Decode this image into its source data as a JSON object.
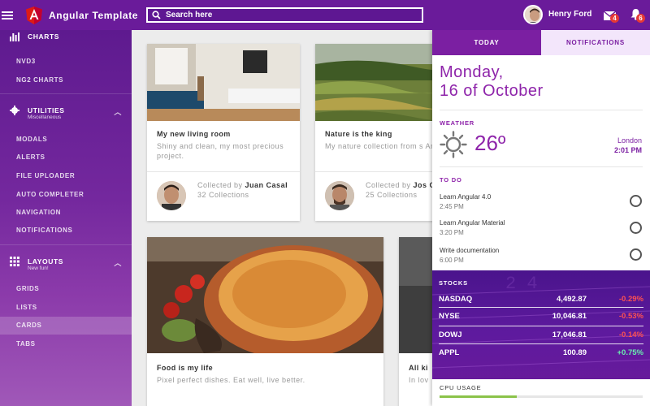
{
  "app": {
    "title": "Angular Template"
  },
  "search": {
    "placeholder": "Search here"
  },
  "user": {
    "name": "Henry Ford",
    "mail_count": "4",
    "notif_count": "6"
  },
  "sidebar": {
    "groups": [
      {
        "label": "CHARTS",
        "items": [
          "NVD3",
          "NG2 CHARTS"
        ]
      },
      {
        "label": "UTILITIES",
        "sub": "Miscellaneous",
        "items": [
          "MODALS",
          "ALERTS",
          "FILE UPLOADER",
          "AUTO COMPLETER",
          "NAVIGATION",
          "NOTIFICATIONS"
        ]
      },
      {
        "label": "LAYOUTS",
        "sub": "New fun!",
        "items": [
          "GRIDS",
          "LISTS",
          "CARDS",
          "TABS"
        ]
      }
    ],
    "active_item": "CARDS"
  },
  "cards": [
    {
      "title": "My new living room",
      "desc": "Shiny and clean, my most precious project.",
      "collected_by_prefix": "Collected by",
      "collector": "Juan Casal",
      "collections": "32 Collections"
    },
    {
      "title": "Nature is the king",
      "desc": "My nature collection from s Amercia.",
      "collected_by_prefix": "Collected by",
      "collector": "Jos Gomez",
      "collections": "25 Collections"
    },
    {
      "title": "Food is my life",
      "desc": "Pixel perfect dishes. Eat well, live better."
    },
    {
      "title": "All ki",
      "desc": "In lov"
    }
  ],
  "panel": {
    "tabs": [
      "TODAY",
      "NOTIFICATIONS"
    ],
    "day": "Monday,",
    "date": "16 of October",
    "weather_label": "WEATHER",
    "temperature": "26º",
    "city": "London",
    "time": "2:01 PM",
    "todo_label": "TO DO",
    "todos": [
      {
        "task": "Learn Angular 4.0",
        "time": "2:45 PM"
      },
      {
        "task": "Learn Angular Material",
        "time": "3:20 PM"
      },
      {
        "task": "Write documentation",
        "time": "6:00 PM"
      }
    ],
    "stocks_label": "STOCKS",
    "stocks": [
      {
        "name": "NASDAQ",
        "value": "4,492.87",
        "change": "-0.29%",
        "color": "#ff5252"
      },
      {
        "name": "NYSE",
        "value": "10,046.81",
        "change": "-0.53%",
        "color": "#ff5252"
      },
      {
        "name": "DOWJ",
        "value": "17,046.81",
        "change": "-0.14%",
        "color": "#ff5252"
      },
      {
        "name": "APPL",
        "value": "100.89",
        "change": "+0.75%",
        "color": "#69f0ae"
      }
    ],
    "cpu_label": "CPU USAGE",
    "cpu_level": 0.38
  },
  "colors": {
    "primary": "#6a1b9a",
    "accent": "#8e24aa"
  }
}
